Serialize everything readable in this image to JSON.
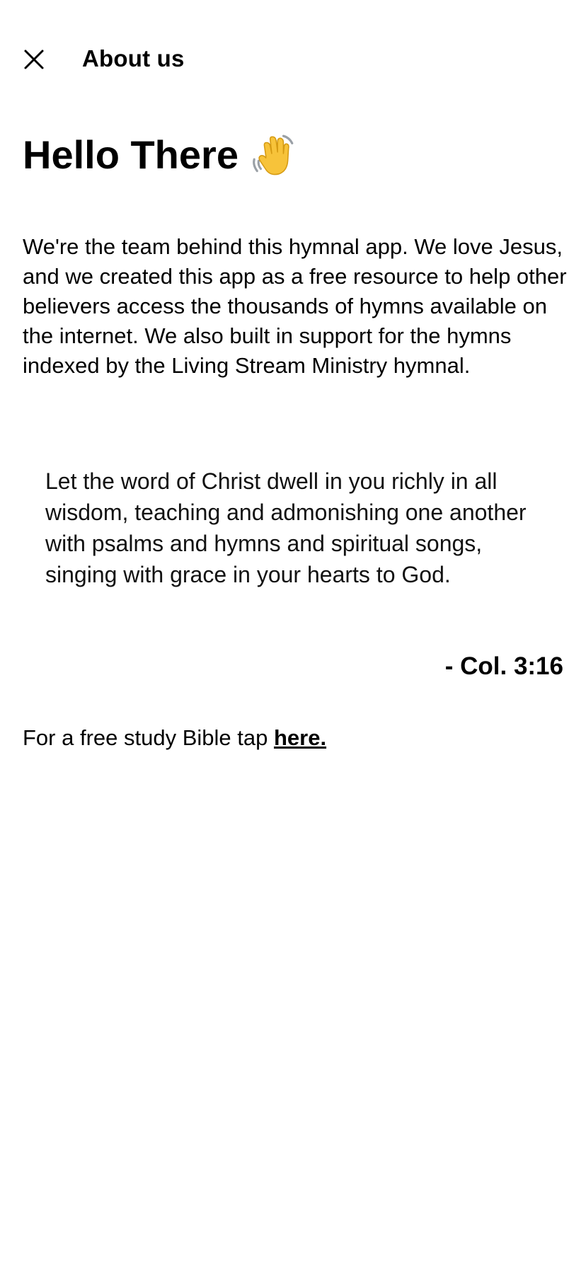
{
  "header": {
    "title": "About us",
    "close_icon": "close-icon"
  },
  "content": {
    "greeting": "Hello There",
    "greeting_icon": "waving-hand-icon",
    "intro": "We're the team behind this hymnal app. We love Jesus, and we created this app as a free resource to help other believers access the thousands of hymns available on the internet. We also built in support for the hymns indexed by the Living Stream Ministry hymnal.",
    "quote": "Let the word of Christ dwell in you richly in all wisdom, teaching and admonishing one another with psalms and hymns and spiritual songs, singing with grace in your hearts to God.",
    "citation": "- Col. 3:16",
    "bible_prompt": "For a free study Bible tap ",
    "bible_link": "here."
  },
  "colors": {
    "background": "#ffffff",
    "text": "#000000",
    "wave_yellow": "#f7c33a"
  }
}
